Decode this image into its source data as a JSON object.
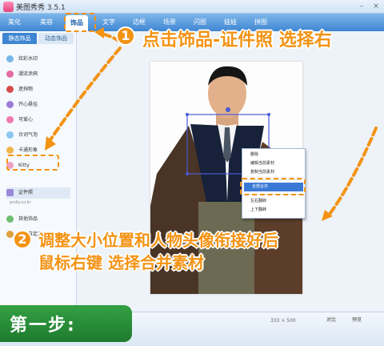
{
  "app": {
    "title": "美图秀秀 3.5.1"
  },
  "nav": {
    "tabs": [
      "美化",
      "美容",
      "饰品",
      "文字",
      "边框",
      "场景",
      "闪图",
      "娃娃",
      "拼图"
    ],
    "active": "饰品"
  },
  "sidebar": {
    "subtabs": [
      "静态饰品",
      "动态饰品"
    ],
    "items": [
      "炫彩水印",
      "潮流涂鸦",
      "遮挡物",
      "开心悬挂",
      "可爱心",
      "台词气泡",
      "卡通形象",
      "Kitty",
      "证件照",
      "其他饰品",
      "用户自定义"
    ],
    "subtext": "pcdiy.co.kr"
  },
  "context_menu": {
    "items": [
      "删除",
      "编辑当前素材",
      "复制当前素材",
      "全部合并",
      "左右翻转",
      "上下翻转"
    ],
    "active": "全部合并"
  },
  "status": {
    "size": "333 × 500",
    "compare": "对比",
    "preview": "预览"
  },
  "annotations": {
    "step1_num": "1",
    "step1_text": "点击饰品-证件照 选择右",
    "step2_num": "2",
    "step2_line1": "调整大小位置和人物头像衔接好后",
    "step2_line2": "鼠标右键 选择合并素材",
    "step_label": "第一步:"
  },
  "colors": {
    "accent": "#f39314",
    "nav": "#3f86d2",
    "step": "#2a9438"
  }
}
